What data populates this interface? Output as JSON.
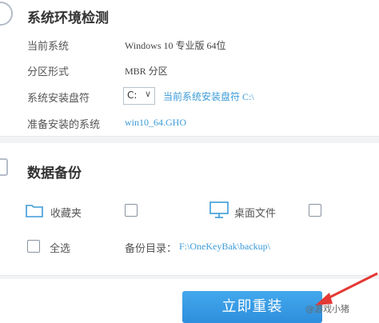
{
  "env_section": {
    "title": "系统环境检测",
    "rows": [
      {
        "label": "当前系统",
        "value": "Windows 10 专业版 64位"
      },
      {
        "label": "分区形式",
        "value": "MBR 分区"
      },
      {
        "label": "系统安装盘符",
        "select_value": "C:",
        "link": "当前系统安装盘符 C:\\"
      },
      {
        "label": "准备安装的系统",
        "value": "win10_64.GHO"
      }
    ]
  },
  "backup_section": {
    "title": "数据备份",
    "favorites_label": "收藏夹",
    "desktop_label": "桌面文件",
    "select_all_label": "全选",
    "backup_dir_label": "备份目录：",
    "backup_dir_value": "F:\\OneKeyBak\\backup\\"
  },
  "install_button": "立即重装",
  "watermark": "@游戏小猪",
  "colors": {
    "accent": "#3b9bd8",
    "button": "#3597e3",
    "arrow": "#e53935"
  }
}
